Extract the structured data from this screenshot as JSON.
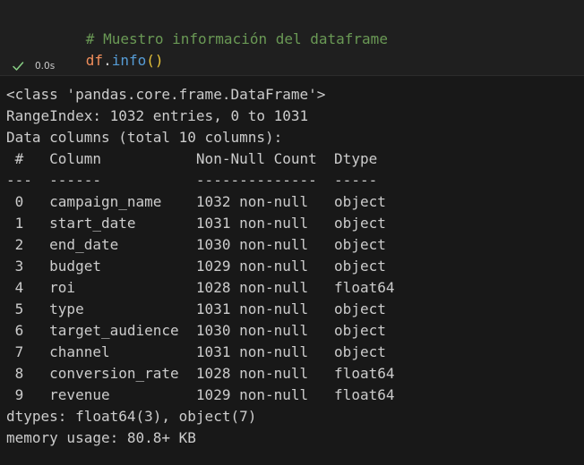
{
  "code": {
    "comment": "# Muestro información del dataframe",
    "variable": "df",
    "dot": ".",
    "method": "info",
    "parens": "()"
  },
  "execution": {
    "status_icon": "check-icon",
    "status_color": "#89d185",
    "time": "0.0s"
  },
  "output": {
    "lines": [
      "<class 'pandas.core.frame.DataFrame'>",
      "RangeIndex: 1032 entries, 0 to 1031",
      "Data columns (total 10 columns):",
      " #   Column           Non-Null Count  Dtype  ",
      "---  ------           --------------  -----  ",
      " 0   campaign_name    1032 non-null   object ",
      " 1   start_date       1031 non-null   object ",
      " 2   end_date         1030 non-null   object ",
      " 3   budget           1029 non-null   object ",
      " 4   roi              1028 non-null   float64",
      " 5   type             1031 non-null   object ",
      " 6   target_audience  1030 non-null   object ",
      " 7   channel          1031 non-null   object ",
      " 8   conversion_rate  1028 non-null   float64",
      " 9   revenue          1029 non-null   float64",
      "dtypes: float64(3), object(7)",
      "memory usage: 80.8+ KB"
    ]
  }
}
